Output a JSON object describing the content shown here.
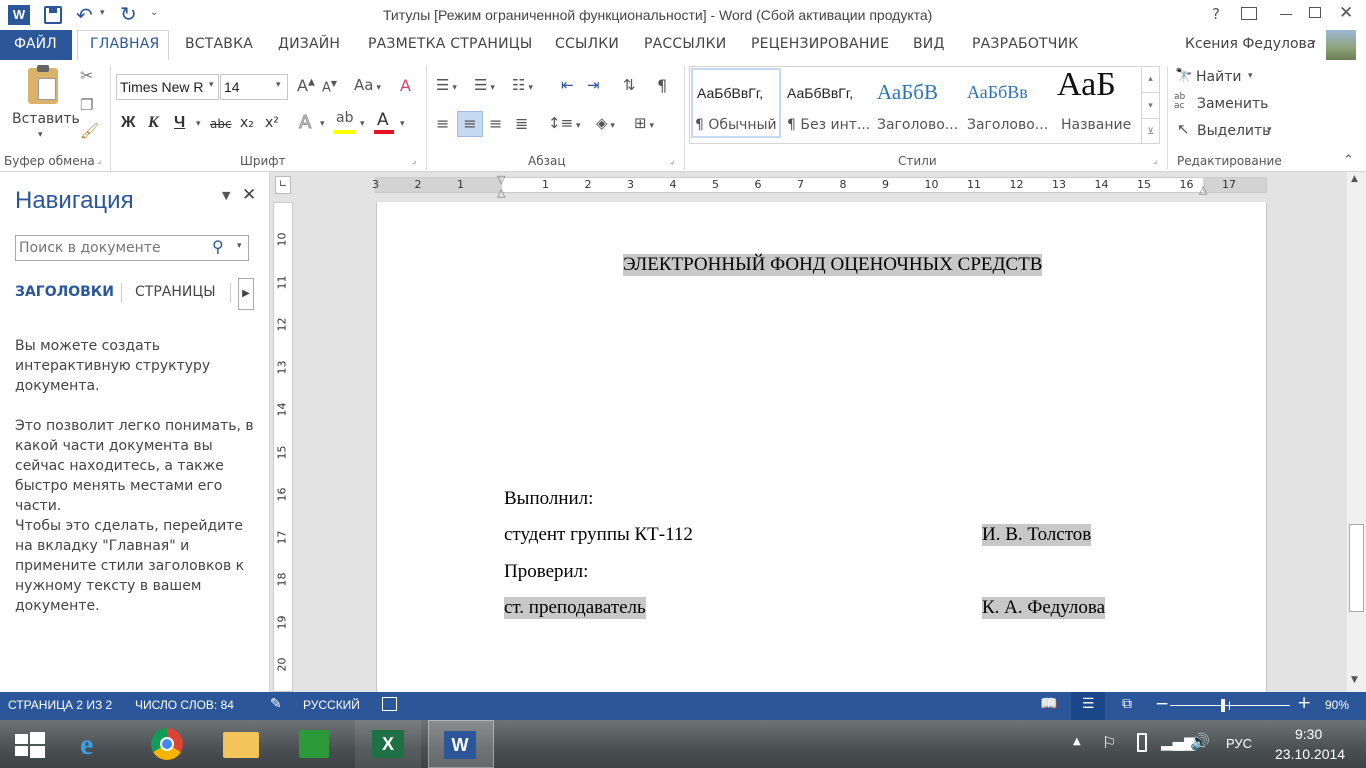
{
  "window": {
    "title": "Титулы [Режим ограниченной функциональности] - Word (Сбой активации продукта)",
    "help_icon": "?",
    "user_name": "Ксения Федулова"
  },
  "tabs": {
    "file": "ФАЙЛ",
    "items": [
      "ГЛАВНАЯ",
      "ВСТАВКА",
      "ДИЗАЙН",
      "РАЗМЕТКА СТРАНИЦЫ",
      "ССЫЛКИ",
      "РАССЫЛКИ",
      "РЕЦЕНЗИРОВАНИЕ",
      "ВИД",
      "РАЗРАБОТЧИК"
    ],
    "active": "ГЛАВНАЯ"
  },
  "ribbon": {
    "clipboard": {
      "paste_label": "Вставить",
      "group_label": "Буфер обмена"
    },
    "font": {
      "font_name": "Times New R",
      "font_size": "14",
      "group_label": "Шрифт",
      "aa_label": "Aa",
      "bold": "Ж",
      "italic": "К",
      "underline": "Ч",
      "strike": "abc",
      "sub": "x₂",
      "sup": "x²"
    },
    "paragraph": {
      "group_label": "Абзац",
      "pilcrow": "¶"
    },
    "styles": {
      "group_label": "Стили",
      "items": [
        {
          "preview": "АаБбВвГг,",
          "label": "¶ Обычный"
        },
        {
          "preview": "АаБбВвГг,",
          "label": "¶ Без инт..."
        },
        {
          "preview": "АаБбВ",
          "label": "Заголово..."
        },
        {
          "preview": "АаБбВв",
          "label": "Заголово..."
        },
        {
          "preview": "АаБ",
          "label": "Название"
        }
      ]
    },
    "editing": {
      "group_label": "Редактирование",
      "find": "Найти",
      "replace": "Заменить",
      "select": "Выделить"
    }
  },
  "nav": {
    "title": "Навигация",
    "search_placeholder": "Поиск в документе",
    "tab_headings": "ЗАГОЛОВКИ",
    "tab_pages": "СТРАНИЦЫ",
    "para1": "Вы можете создать интерактивную структуру документа.",
    "para2": "Это позволит легко понимать, в какой части документа вы сейчас находитесь, а также быстро менять местами его части.",
    "para3": "Чтобы это сделать, перейдите на вкладку \"Главная\" и примените стили заголовков к нужному тексту в вашем документе."
  },
  "ruler": {
    "h_numbers": [
      "3",
      "2",
      "1",
      "1",
      "2",
      "3",
      "4",
      "5",
      "6",
      "7",
      "8",
      "9",
      "10",
      "11",
      "12",
      "13",
      "14",
      "15",
      "16",
      "17"
    ],
    "v_numbers": [
      "10",
      "11",
      "12",
      "13",
      "14",
      "15",
      "16",
      "17",
      "18",
      "19",
      "20"
    ]
  },
  "document": {
    "heading": "ЭЛЕКТРОННЫЙ ФОНД ОЦЕНОЧНЫХ СРЕДСТВ",
    "performed": "Выполнил:",
    "student": "студент группы КТ-112",
    "student_name": "И. В. Толстов",
    "checked": "Проверил:",
    "teacher": "ст. преподаватель",
    "teacher_name": "К. А. Федулова"
  },
  "status": {
    "page": "СТРАНИЦА 2 ИЗ 2",
    "words": "ЧИСЛО СЛОВ: 84",
    "language": "РУССКИЙ",
    "zoom": "90%",
    "zoom_value": 0.9
  },
  "taskbar": {
    "lang": "РУС",
    "time": "9:30",
    "date": "23.10.2014"
  },
  "colors": {
    "accent": "#2b579a",
    "highlight": "#c8c8c8"
  }
}
